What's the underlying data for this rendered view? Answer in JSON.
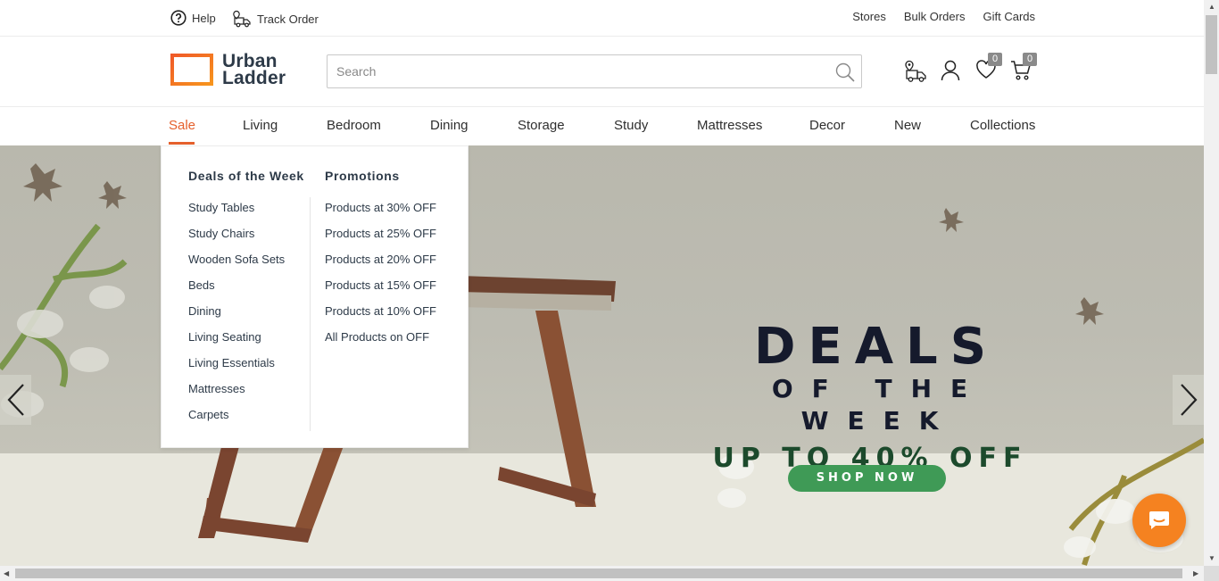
{
  "topbar": {
    "help_label": "Help",
    "track_label": "Track Order",
    "right_links": [
      "Stores",
      "Bulk Orders",
      "Gift Cards"
    ]
  },
  "header": {
    "logo_line1": "Urban",
    "logo_line2": "Ladder",
    "search_placeholder": "Search",
    "wishlist_count": "0",
    "cart_count": "0"
  },
  "nav": {
    "items": [
      "Sale",
      "Living",
      "Bedroom",
      "Dining",
      "Storage",
      "Study",
      "Mattresses",
      "Decor",
      "New",
      "Collections"
    ],
    "active": "Sale"
  },
  "dropdown": {
    "col1_heading": "Deals of the Week",
    "col1_links": [
      "Study Tables",
      "Study Chairs",
      "Wooden Sofa Sets",
      "Beds",
      "Dining",
      "Living Seating",
      "Living Essentials",
      "Mattresses",
      "Carpets"
    ],
    "col2_heading": "Promotions",
    "col2_links": [
      "Products at 30% OFF",
      "Products at 25% OFF",
      "Products at 20% OFF",
      "Products at 15% OFF",
      "Products at 10% OFF",
      "All Products on OFF"
    ]
  },
  "hero": {
    "line1": "DEALS",
    "line2": "OF THE WEEK",
    "line3": "UP TO 40% OFF",
    "cta": "SHOP NOW"
  },
  "colors": {
    "accent": "#e5602c",
    "brand_text": "#2d3a48",
    "cta_green": "#3f9a56",
    "chat_orange": "#f58220"
  },
  "icons": [
    "help-icon",
    "truck-icon",
    "search-icon",
    "delivery-icon",
    "user-icon",
    "heart-icon",
    "cart-icon",
    "chevron-left-icon",
    "chevron-right-icon",
    "chat-icon"
  ]
}
